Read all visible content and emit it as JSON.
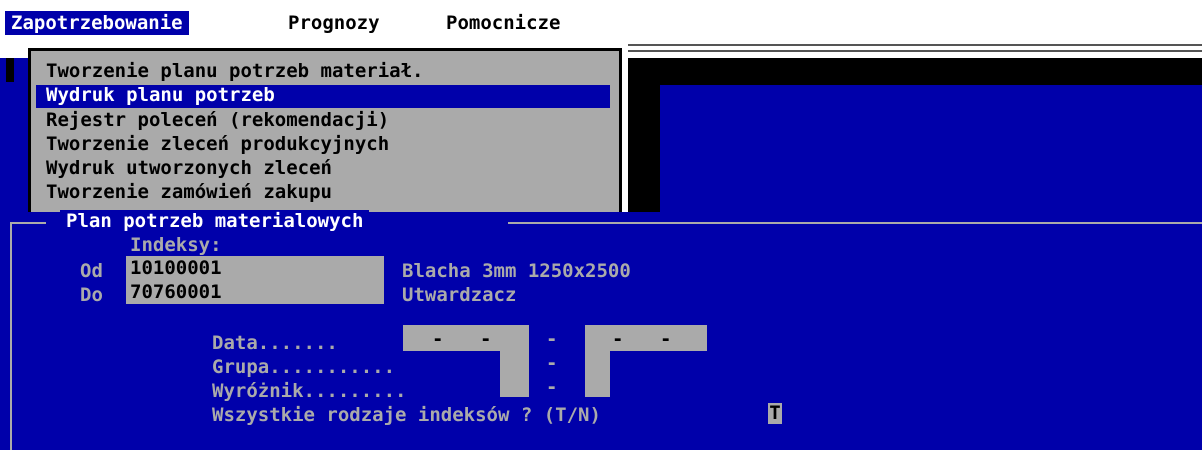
{
  "menubar": {
    "items": [
      "Zapotrzebowanie",
      "Prognozy",
      "Pomocnicze"
    ]
  },
  "dropdown": {
    "items": [
      "Tworzenie planu potrzeb materiał.",
      "Wydruk planu potrzeb",
      "Rejestr poleceń (rekomendacji)",
      "Tworzenie zleceń produkcyjnych",
      "Wydruk utworzonych zleceń",
      "Tworzenie zamówień zakupu"
    ],
    "selected_index": 1
  },
  "form": {
    "title": "Plan potrzeb materialowych",
    "indeksy_label": "Indeksy:",
    "od_label": "Od",
    "do_label": "Do",
    "od_value": "10100001",
    "do_value": "70760001",
    "od_desc": "Blacha 3mm 1250x2500",
    "do_desc": "Utwardzacz",
    "data_label": "Data.......",
    "grupa_label": "Grupa...........",
    "wyroznik_label": "Wyróżnik.........",
    "wszystkie_label": "Wszystkie rodzaje indeksów ? (T/N)",
    "tn_value": "T",
    "dash": "-",
    "date_sep": "-"
  },
  "colors": {
    "blue": "#0000aa",
    "gray": "#aaaaaa",
    "black": "#000000",
    "white": "#ffffff"
  }
}
